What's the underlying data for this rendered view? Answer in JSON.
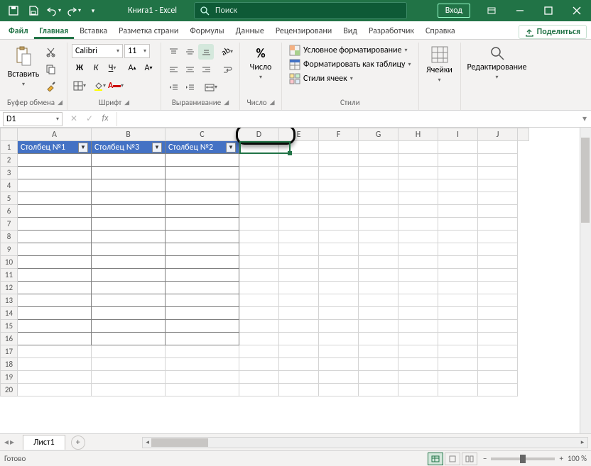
{
  "titlebar": {
    "title": "Книга1 - Excel",
    "search_placeholder": "Поиск",
    "signin": "Вход"
  },
  "tabs": {
    "file": "Файл",
    "home": "Главная",
    "insert": "Вставка",
    "pagelayout": "Разметка страни",
    "formulas": "Формулы",
    "data": "Данные",
    "review": "Рецензировани",
    "view": "Вид",
    "developer": "Разработчик",
    "help": "Справка",
    "share": "Поделиться"
  },
  "ribbon": {
    "clipboard": {
      "paste": "Вставить",
      "label": "Буфер обмена"
    },
    "font": {
      "name": "Calibri",
      "size": "11",
      "label": "Шрифт"
    },
    "alignment": {
      "label": "Выравнивание"
    },
    "number": {
      "big": "Число",
      "label": "Число"
    },
    "styles": {
      "cond": "Условное форматирование",
      "table": "Форматировать как таблицу",
      "cell": "Стили ячеек",
      "label": "Стили"
    },
    "cells": {
      "big": "Ячейки",
      "label": ""
    },
    "editing": {
      "big": "Редактирование",
      "label": ""
    }
  },
  "formulabar": {
    "namebox": "D1",
    "fx": "fx"
  },
  "grid": {
    "cols": [
      "A",
      "B",
      "C",
      "D",
      "E",
      "F",
      "G",
      "H",
      "I",
      "J"
    ],
    "headers": [
      "Столбец №1",
      "Столбец №3",
      "Столбец №2"
    ],
    "rows": 20,
    "tableRows": 16
  },
  "sheet": {
    "tab": "Лист1"
  },
  "status": {
    "ready": "Готово",
    "zoom": "100 %"
  }
}
